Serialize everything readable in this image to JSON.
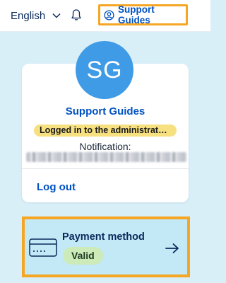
{
  "header": {
    "language": "English",
    "support_button_label": "Support Guides"
  },
  "profile": {
    "initials": "SG",
    "name": "Support Guides",
    "role_badge": "Logged in to the administrato...",
    "notification_label": "Notification:",
    "logout_label": "Log out"
  },
  "payment": {
    "title": "Payment method",
    "status": "Valid"
  },
  "colors": {
    "accent": "#0051c2",
    "highlight_border": "#f5a623",
    "page_bg": "#d9eff8",
    "avatar": "#3f9be6",
    "valid_badge": "#ccebb8",
    "role_badge": "#f6e07f"
  },
  "icons": [
    "chevron-down-icon",
    "bell-icon",
    "user-circle-icon",
    "credit-card-icon",
    "arrow-right-icon"
  ]
}
